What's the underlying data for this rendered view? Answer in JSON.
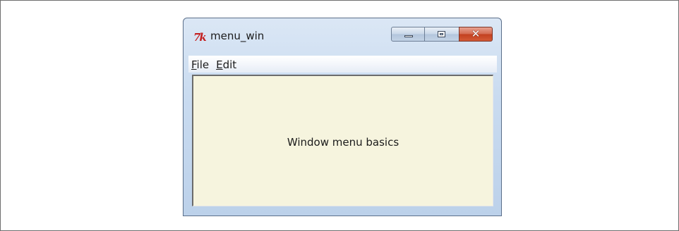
{
  "window": {
    "title": "menu_win",
    "logo_text": "7k",
    "caption_buttons": {
      "minimize": "",
      "maximize": "",
      "close": "✕"
    }
  },
  "menubar": {
    "items": [
      {
        "accel": "F",
        "rest": "ile"
      },
      {
        "accel": "E",
        "rest": "dit"
      }
    ]
  },
  "content": {
    "label": "Window menu basics"
  },
  "colors": {
    "content_bg": "#f6f4de",
    "close_button": "#c2401f",
    "logo": "#c41e1e"
  }
}
